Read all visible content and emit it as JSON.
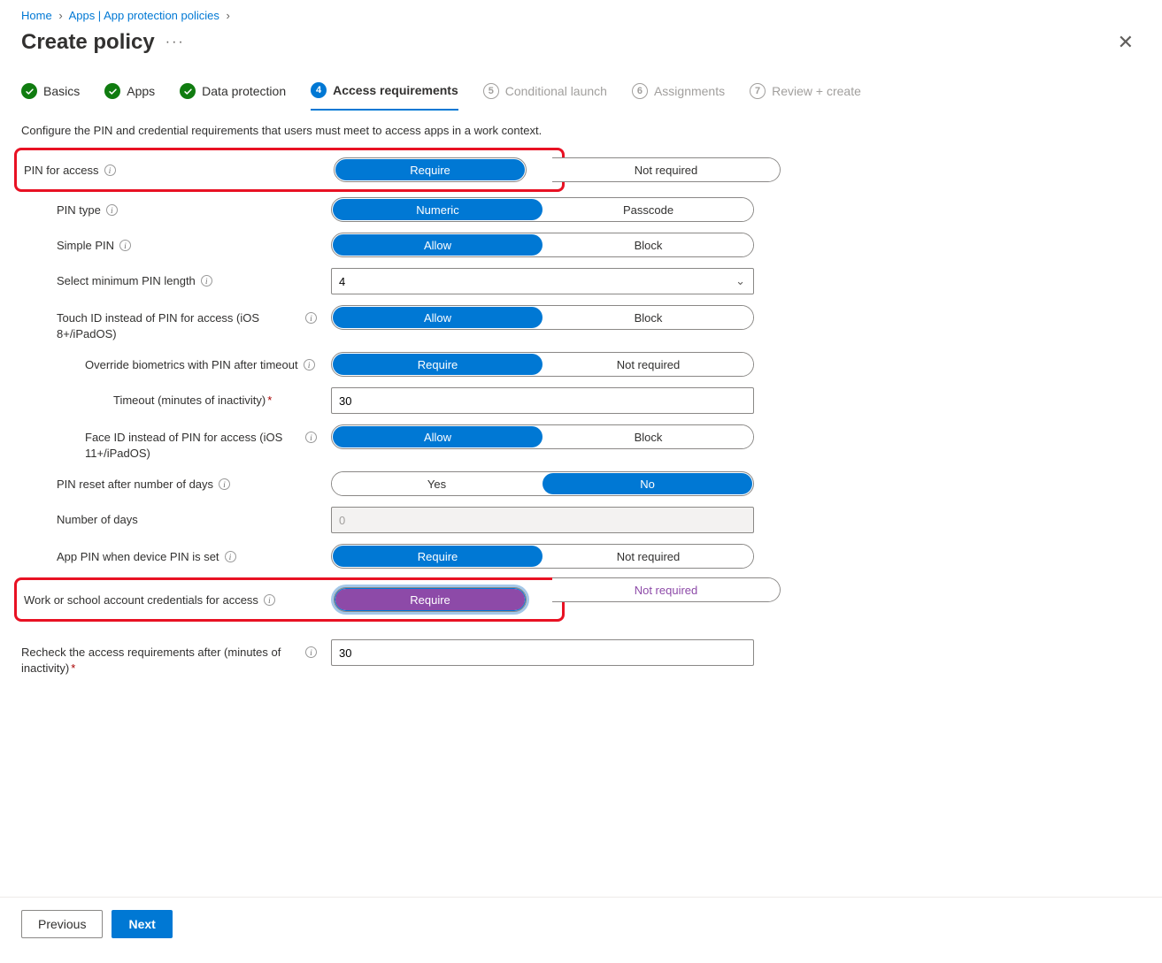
{
  "breadcrumb": {
    "home": "Home",
    "apps": "Apps | App protection policies"
  },
  "title": "Create policy",
  "tabs": {
    "basics": "Basics",
    "apps": "Apps",
    "data": "Data protection",
    "access": "Access requirements",
    "cond": "Conditional launch",
    "assign": "Assignments",
    "review": "Review + create",
    "n4": "4",
    "n5": "5",
    "n6": "6",
    "n7": "7"
  },
  "description": "Configure the PIN and credential requirements that users must meet to access apps in a work context.",
  "fields": {
    "pin_access": {
      "label": "PIN for access",
      "opt_a": "Require",
      "opt_b": "Not required",
      "selected": "a"
    },
    "pin_type": {
      "label": "PIN type",
      "opt_a": "Numeric",
      "opt_b": "Passcode",
      "selected": "a"
    },
    "simple_pin": {
      "label": "Simple PIN",
      "opt_a": "Allow",
      "opt_b": "Block",
      "selected": "a"
    },
    "min_len": {
      "label": "Select minimum PIN length",
      "value": "4"
    },
    "touch_id": {
      "label": "Touch ID instead of PIN for access (iOS 8+/iPadOS)",
      "opt_a": "Allow",
      "opt_b": "Block",
      "selected": "a"
    },
    "override_bio": {
      "label": "Override biometrics with PIN after timeout",
      "opt_a": "Require",
      "opt_b": "Not required",
      "selected": "a"
    },
    "timeout": {
      "label": "Timeout (minutes of inactivity)",
      "value": "30"
    },
    "face_id": {
      "label": "Face ID instead of PIN for access (iOS 11+/iPadOS)",
      "opt_a": "Allow",
      "opt_b": "Block",
      "selected": "a"
    },
    "pin_reset": {
      "label": "PIN reset after number of days",
      "opt_a": "Yes",
      "opt_b": "No",
      "selected": "b"
    },
    "num_days": {
      "label": "Number of days",
      "value": "0"
    },
    "app_pin_device": {
      "label": "App PIN when device PIN is set",
      "opt_a": "Require",
      "opt_b": "Not required",
      "selected": "a"
    },
    "work_creds": {
      "label": "Work or school account credentials for access",
      "opt_a": "Require",
      "opt_b": "Not required",
      "selected": "a"
    },
    "recheck": {
      "label": "Recheck the access requirements after (minutes of inactivity)",
      "value": "30"
    }
  },
  "footer": {
    "prev": "Previous",
    "next": "Next"
  }
}
